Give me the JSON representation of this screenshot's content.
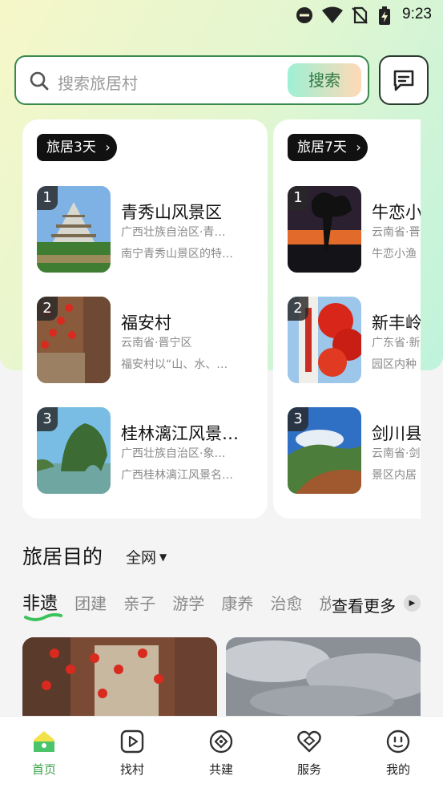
{
  "status_bar": {
    "time": "9:23",
    "icons": [
      "do-not-disturb-icon",
      "wifi-icon",
      "no-sim-icon",
      "battery-charging-icon"
    ]
  },
  "search": {
    "placeholder": "搜索旅居村",
    "button_label": "搜索",
    "message_icon": "message-icon"
  },
  "cards": [
    {
      "tag": "旅居3天",
      "spots": [
        {
          "rank": "1",
          "name": "青秀山风景区",
          "region": "广西壮族自治区·青…",
          "desc": "南宁青秀山景区的特…"
        },
        {
          "rank": "2",
          "name": "福安村",
          "region": "云南省·晋宁区",
          "desc": "福安村以“山、水、…"
        },
        {
          "rank": "3",
          "name": "桂林漓江风景…",
          "region": "广西壮族自治区·象…",
          "desc": "广西桂林漓江风景名…"
        }
      ]
    },
    {
      "tag": "旅居7天",
      "spots": [
        {
          "rank": "1",
          "name": "牛恋小",
          "region": "云南省·晋",
          "desc": "牛恋小渔"
        },
        {
          "rank": "2",
          "name": "新丰岭",
          "region": "广东省·新",
          "desc": "园区内种"
        },
        {
          "rank": "3",
          "name": "剑川县",
          "region": "云南省·剑",
          "desc": "景区内居"
        }
      ]
    }
  ],
  "section": {
    "title": "旅居目的",
    "scope": "全网"
  },
  "tabs": [
    "非遗",
    "团建",
    "亲子",
    "游学",
    "康养",
    "治愈",
    "放"
  ],
  "more_label": "查看更多",
  "bottom_nav": [
    {
      "label": "首页",
      "icon": "home-icon",
      "active": true
    },
    {
      "label": "找村",
      "icon": "play-village-icon",
      "active": false
    },
    {
      "label": "共建",
      "icon": "co-build-icon",
      "active": false
    },
    {
      "label": "服务",
      "icon": "service-heart-icon",
      "active": false
    },
    {
      "label": "我的",
      "icon": "profile-face-icon",
      "active": false
    }
  ],
  "colors": {
    "accent_green": "#3aa04a",
    "search_border": "#3a8a4e"
  }
}
